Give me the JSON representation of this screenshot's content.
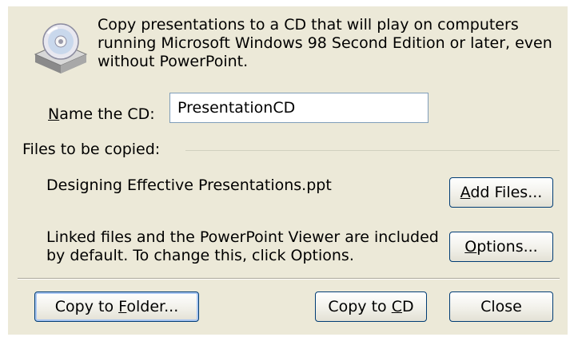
{
  "description": "Copy presentations to a CD that will play on computers running Microsoft Windows 98 Second Edition or later, even without PowerPoint.",
  "name_field": {
    "label_accel": "N",
    "label_rest": "ame the CD:",
    "value": "PresentationCD"
  },
  "files_group": {
    "label": "Files to be copied:",
    "file_name": "Designing Effective Presentations.ppt",
    "linked_note": "Linked files and the PowerPoint Viewer are included by default. To change this, click Options."
  },
  "buttons": {
    "add_files": {
      "accel": "A",
      "rest": "dd Files..."
    },
    "options": {
      "accel": "O",
      "rest": "ptions..."
    },
    "copy_to_folder": {
      "pre": "Copy to ",
      "accel": "F",
      "rest": "older..."
    },
    "copy_to_cd": {
      "pre": "Copy to ",
      "accel": "C",
      "rest": "D"
    },
    "close": {
      "label": "Close"
    }
  },
  "icons": {
    "cd": "cd-drive-icon"
  },
  "colors": {
    "dialog_bg": "#ece9d8",
    "button_border": "#003c74",
    "input_border": "#7f9db9"
  }
}
